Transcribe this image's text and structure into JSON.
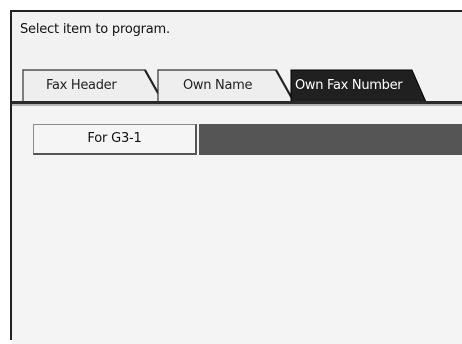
{
  "screen": {
    "prompt": "Select item to program."
  },
  "tabs": [
    {
      "label": "Fax Header",
      "active": false
    },
    {
      "label": "Own Name",
      "active": false
    },
    {
      "label": "Own Fax Number",
      "active": true
    }
  ],
  "field": {
    "label": "For G3-1",
    "value": ""
  },
  "colors": {
    "active_tab": "#202020",
    "value_bar": "#555555",
    "panel_background": "#f2f2f2"
  }
}
